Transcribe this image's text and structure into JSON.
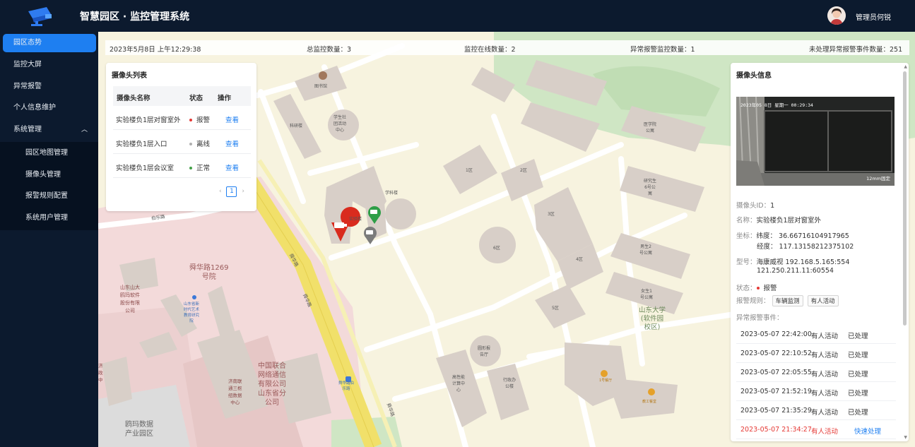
{
  "app": {
    "title": "智慧园区 · 监控管理系统",
    "user": "管理员何锐"
  },
  "sidebar": {
    "items": [
      {
        "label": "园区态势"
      },
      {
        "label": "监控大屏"
      },
      {
        "label": "异常报警"
      },
      {
        "label": "个人信息维护"
      },
      {
        "label": "系统管理"
      }
    ],
    "subitems": [
      {
        "label": "园区地图管理"
      },
      {
        "label": "摄像头管理"
      },
      {
        "label": "报警规则配置"
      },
      {
        "label": "系统用户管理"
      }
    ]
  },
  "stats": {
    "datetime": "2023年5月8日 上午12:29:38",
    "total": "总监控数量：3",
    "online": "监控在线数量：2",
    "abnormal": "异常报警监控数量：1",
    "unhandled": "未处理异常报警事件数量：251"
  },
  "camera_list": {
    "title": "摄像头列表",
    "headers": [
      "摄像头名称",
      "状态",
      "操作"
    ],
    "rows": [
      {
        "name": "实验楼负1层对窗室外",
        "status": "报警",
        "status_color": "#e53935",
        "action": "查看"
      },
      {
        "name": "实验楼负1层入口",
        "status": "离线",
        "status_color": "#b0b0b0",
        "action": "查看"
      },
      {
        "name": "实验楼负1层会议室",
        "status": "正常",
        "status_color": "#43a047",
        "action": "查看"
      }
    ],
    "page": "1",
    "prev": "‹",
    "next": "›"
  },
  "camera_info": {
    "title": "摄像头信息",
    "video_timestamp": "2023年05 8日 星期一 00:29:34",
    "video_caption": "12mm固定",
    "id_label": "摄像头ID：",
    "id": "1",
    "name_label": "名称：",
    "name": "实验楼负1层对窗室外",
    "coord_label": "坐标：",
    "lat": "纬度：  36.66716104917965",
    "lng": "经度：  117.13158212375102",
    "model_label": "型号：",
    "model": "海康威视 192.168.5.165:554",
    "model2": "121.250.211.11:60554",
    "status_label": "状态：",
    "status": "报警",
    "rules_label": "报警规则：",
    "rules": [
      "车辆监测",
      "有人活动"
    ],
    "events_label": "异常报警事件：",
    "events": [
      {
        "time": "2023-05-07 22:42:00",
        "type": "有人活动",
        "state": "已处理",
        "alert": false
      },
      {
        "time": "2023-05-07 22:10:52",
        "type": "有人活动",
        "state": "已处理",
        "alert": false
      },
      {
        "time": "2023-05-07 22:05:55",
        "type": "有人活动",
        "state": "已处理",
        "alert": false
      },
      {
        "time": "2023-05-07 21:52:19",
        "type": "有人活动",
        "state": "已处理",
        "alert": false
      },
      {
        "time": "2023-05-07 21:35:29",
        "type": "有人活动",
        "state": "已处理",
        "alert": false
      },
      {
        "time": "2023-05-07 21:34:27",
        "type": "有人活动",
        "state": "快速处理",
        "alert": true
      }
    ]
  },
  "map_labels": {
    "library": "图书馆",
    "research": "科研楼",
    "student": "学生社\n团活动\n中心",
    "xueke": "学科楼",
    "lab": "实验楼",
    "z1": "1区",
    "z2": "2区",
    "z3": "3区",
    "z4": "4区",
    "z5": "5区",
    "z6": "6区",
    "med": "医学院\n公寓",
    "res6": "研究生\n6号公\n寓",
    "male2": "男生2\n号公寓",
    "female1": "女生1\n号公寓",
    "sdu": "山东大学\n(软件园\n校区)",
    "yuanxing": "圆形报\n告厅",
    "gaoxing": "高性能\n计算中\n心",
    "xingzheng": "行政办\n公楼",
    "canteen1": "1号餐厅",
    "canteen2": "教工餐堂",
    "shunhua1269": "舜华路1269\n号院",
    "shandong_soft": "山东山大\n鸥玛软件\n股份有限\n公司",
    "shandong_art": "山东省新\n时代艺术\n教育研究\n院",
    "unicom": "中国联合\n网络通信\n有限公司\n山东省分\n公司",
    "jinan": "济南联\n通三枢\n纽数据\n中心",
    "ouma": "鸥玛数据\n产业园区",
    "bole": "伯乐路",
    "shunhua_road": "舜华路",
    "shunhua_road2": "舜华路",
    "shunhua_road3": "舜华路",
    "bus": "舜华路伯\n乐路",
    "jizheng": "济\n政\n中"
  }
}
